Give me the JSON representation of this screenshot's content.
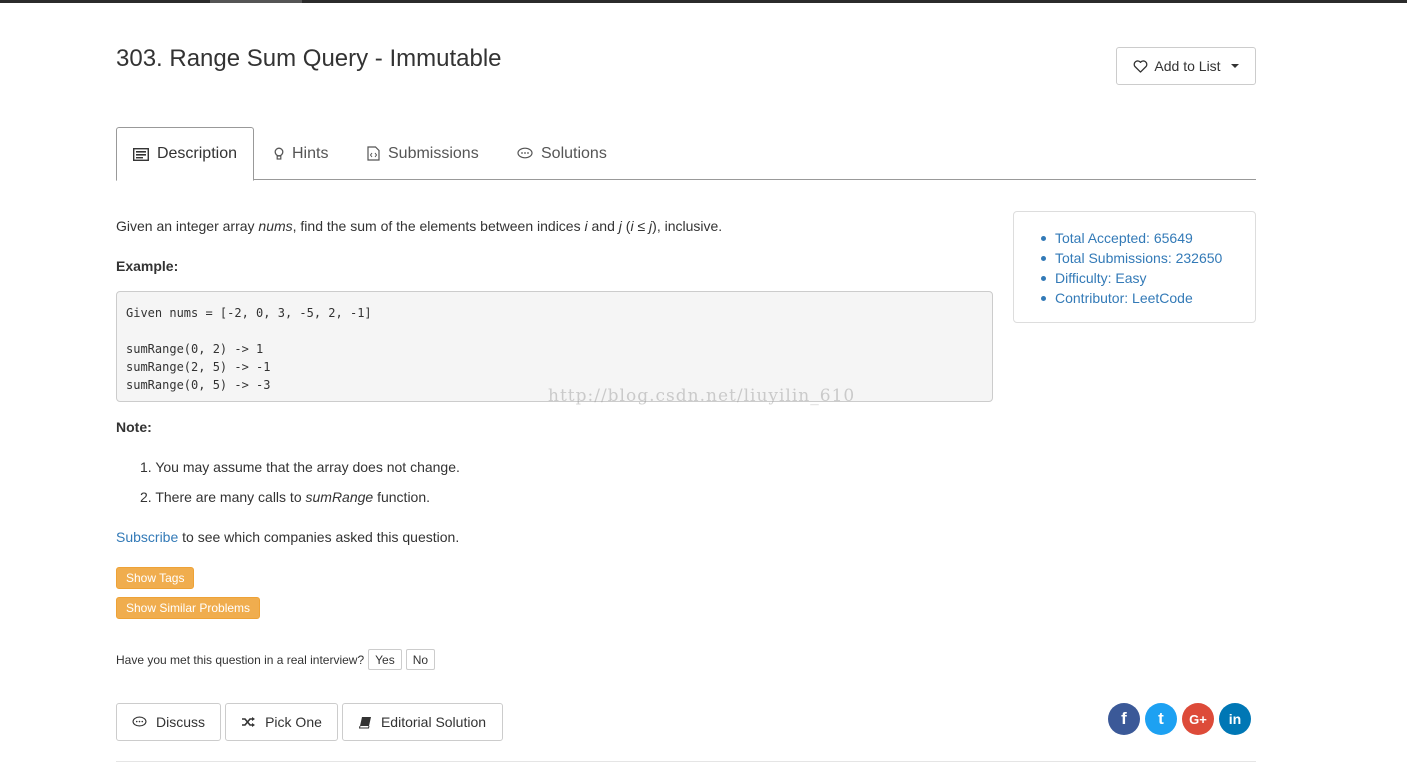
{
  "problem": {
    "title": "303. Range Sum Query - Immutable",
    "add_to_list": "Add to List"
  },
  "tabs": [
    {
      "label": "Description",
      "icon": "description-icon"
    },
    {
      "label": "Hints",
      "icon": "lightbulb-icon"
    },
    {
      "label": "Submissions",
      "icon": "code-file-icon"
    },
    {
      "label": "Solutions",
      "icon": "comment-icon"
    }
  ],
  "description": {
    "p1": "Given an integer array ",
    "p2": "nums",
    "p3": ", find the sum of the elements between indices ",
    "p4": "i",
    "p5": " and ",
    "p6": "j",
    "p7": " (",
    "p8": "i",
    "p9": " ≤ ",
    "p10": "j",
    "p11": "), inclusive."
  },
  "example": {
    "heading": "Example:",
    "code": [
      "Given nums = [-2, 0, 3, -5, 2, -1]",
      "",
      "sumRange(0, 2) -> 1",
      "sumRange(2, 5) -> -1",
      "sumRange(0, 5) -> -3"
    ]
  },
  "watermark": "http://blog.csdn.net/liuyilin_610",
  "note": {
    "heading": "Note:",
    "items": [
      {
        "num": "1.",
        "text": "You may assume that the array does not change."
      },
      {
        "num": "2.",
        "text": "There are many calls to ",
        "em": "sumRange",
        "tail": " function."
      }
    ]
  },
  "subscribe": {
    "link": "Subscribe",
    "text": " to see which companies asked this question."
  },
  "tags": {
    "show_tags": "Show Tags",
    "show_similar": "Show Similar Problems"
  },
  "interview": {
    "question": "Have you met this question in a real interview?",
    "yes": "Yes",
    "no": "No"
  },
  "actions": {
    "discuss": "Discuss",
    "pick_one": "Pick One",
    "editorial": "Editorial Solution"
  },
  "social": [
    {
      "name": "facebook",
      "glyph": "f",
      "color": "#3b5998"
    },
    {
      "name": "twitter",
      "glyph": "t",
      "color": "#1da1f2"
    },
    {
      "name": "google-plus",
      "glyph": "G+",
      "color": "#dd4b39"
    },
    {
      "name": "linkedin",
      "glyph": "in",
      "color": "#0077b5"
    }
  ],
  "stats": [
    "Total Accepted: 65649",
    "Total Submissions: 232650",
    "Difficulty: Easy",
    "Contributor: LeetCode"
  ],
  "colors": {
    "link": "#337ab7",
    "tag_button": "#f0ad4e"
  }
}
